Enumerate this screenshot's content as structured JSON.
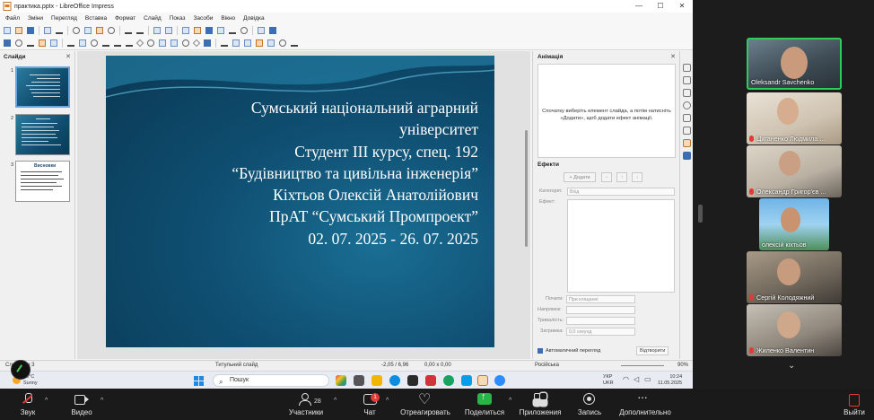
{
  "window": {
    "title": "практика.pptx - LibreOffice Impress",
    "controls": [
      "—",
      "☐",
      "✕"
    ]
  },
  "menu": [
    "Файл",
    "Зміни",
    "Перегляд",
    "Вставка",
    "Формат",
    "Слайд",
    "Показ",
    "Засоби",
    "Вікно",
    "Довідка"
  ],
  "slides_panel": {
    "title": "Слайди",
    "close": "✕",
    "slide_numbers": [
      "1",
      "2",
      "3"
    ],
    "slide3_heading": "Висновки"
  },
  "slide": {
    "lines": [
      "Сумський національний аграрний",
      "університет",
      "Студент ІІІ курсу, спец. 192",
      "“Будівництво та цивільна інженерія”",
      "Кіхтьов Олексій Анатолійович",
      "ПрАТ “Сумський Промпроект”",
      "02. 07. 2025 - 26. 07. 2025"
    ]
  },
  "animation_panel": {
    "title": "Анімація",
    "close": "✕",
    "hint": "Спочатку виберіть елемент слайда, а потім натисніть «Додати», щоб додати ефект анімації.",
    "effects_label": "Ефекти",
    "add_button": "+ Додати",
    "category_label": "Категорія:",
    "category_value": "Вхід",
    "effect_label": "Ефект:",
    "start_label": "Почати:",
    "start_value": "При клацанні",
    "direction_label": "Напрямок:",
    "duration_label": "Тривалість:",
    "delay_label": "Затримка:",
    "delay_value": "0,0 секунд",
    "autopreview": "Автоматичний перегляд",
    "preview_button": "Відтворити"
  },
  "statusbar": {
    "slide_info": "Слайд 1 з 3",
    "layout": "Титульний слайд",
    "position": "-2,05 / 6,96",
    "size": "0,00 x 0,00",
    "language": "Російська",
    "zoom": "90%"
  },
  "taskbar": {
    "weather_temp": "16°C",
    "weather_desc": "Sunny",
    "search_placeholder": "Пошук",
    "lang_top": "УКР",
    "lang_bottom": "UKR",
    "time": "10:24",
    "date": "11.05.2025"
  },
  "participants": [
    {
      "name": "Oleksandr Savchenko",
      "muted": false,
      "active": true
    },
    {
      "name": "Циганенко Людмила ...",
      "muted": true,
      "active": false
    },
    {
      "name": "Олександр Григор'єв ...",
      "muted": true,
      "active": false
    },
    {
      "name": "олексій кіхтьов",
      "muted": false,
      "active": false
    },
    {
      "name": "Сергій Колодяжний",
      "muted": true,
      "active": false
    },
    {
      "name": "Жиленко Валентин",
      "muted": true,
      "active": false
    }
  ],
  "controls": {
    "mute": "Звук",
    "video": "Видео",
    "participants": "Участники",
    "participants_count": "28",
    "chat": "Чат",
    "chat_badge": "1",
    "react": "Отреагировать",
    "share": "Поделиться",
    "apps": "Приложения",
    "record": "Запись",
    "more": "Дополнительно",
    "leave": "Выйти"
  }
}
